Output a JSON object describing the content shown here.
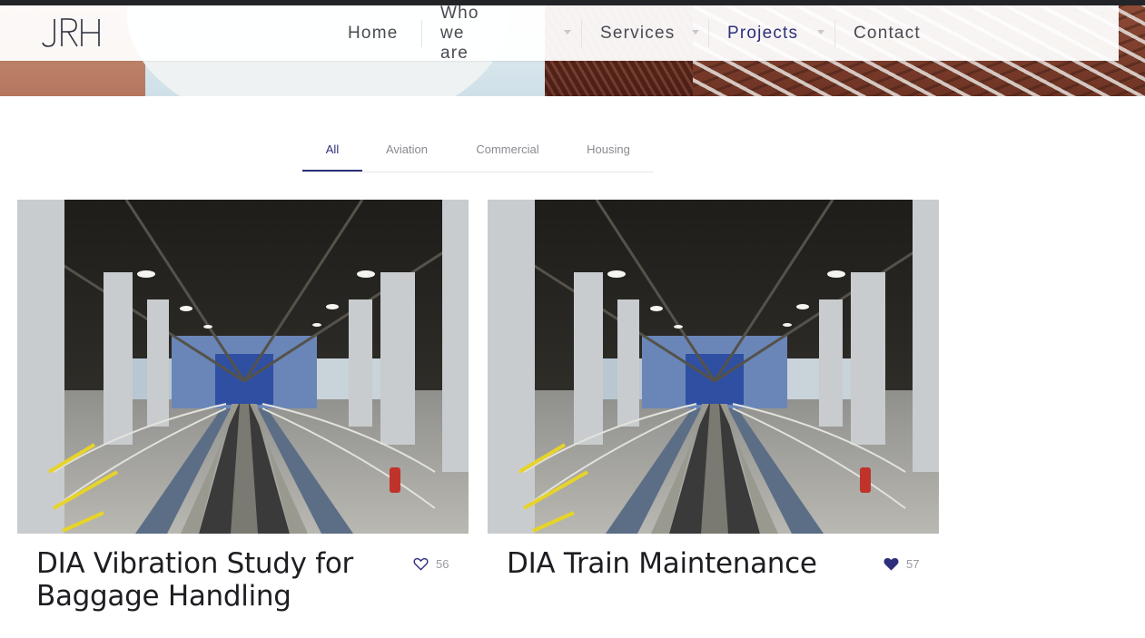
{
  "brand": {
    "logo_text": "JRH"
  },
  "nav": {
    "items": [
      {
        "label": "Home",
        "has_dropdown": false,
        "active": false
      },
      {
        "label": "Who we are",
        "has_dropdown": true,
        "active": false
      },
      {
        "label": "Services",
        "has_dropdown": true,
        "active": false
      },
      {
        "label": "Projects",
        "has_dropdown": true,
        "active": true
      },
      {
        "label": "Contact",
        "has_dropdown": false,
        "active": false
      }
    ]
  },
  "filters": {
    "tabs": [
      "All",
      "Aviation",
      "Commercial",
      "Housing"
    ],
    "active": "All"
  },
  "projects": [
    {
      "title": "DIA Vibration Study for Baggage Handling",
      "likes": "56",
      "liked": false
    },
    {
      "title": "DIA Train Maintenance",
      "likes": "57",
      "liked": true
    }
  ],
  "colors": {
    "accent": "#2d2f7a",
    "nav_text": "#4a4a52",
    "muted": "#8a8a92",
    "title": "#1d1d22"
  }
}
